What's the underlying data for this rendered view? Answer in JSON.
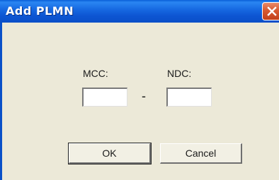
{
  "window": {
    "title": "Add PLMN",
    "close_icon": "close-icon",
    "accent_color": "#0a5fd8",
    "close_color": "#d85a30"
  },
  "form": {
    "mcc_label": "MCC:",
    "mcc_value": "",
    "separator": "-",
    "ndc_label": "NDC:",
    "ndc_value": ""
  },
  "buttons": {
    "ok_label": "OK",
    "cancel_label": "Cancel"
  }
}
